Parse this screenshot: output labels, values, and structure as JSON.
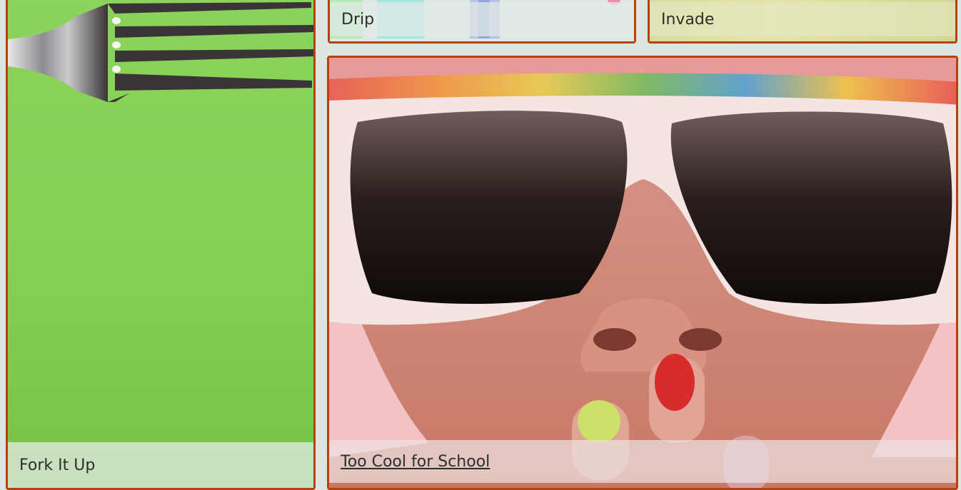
{
  "cards": [
    {
      "id": "fork",
      "caption": "Fork It Up",
      "is_link": false
    },
    {
      "id": "drip",
      "caption": "Drip",
      "is_link": false
    },
    {
      "id": "invade",
      "caption": "Invade",
      "is_link": false
    },
    {
      "id": "cool",
      "caption": "Too Cool for School",
      "is_link": true
    }
  ],
  "colors": {
    "background": "#dce5df",
    "card_border": "#b5420c",
    "caption_text": "#2b2f2a",
    "fork_background": "#85cf55",
    "fork_metal": "#3a3436"
  }
}
